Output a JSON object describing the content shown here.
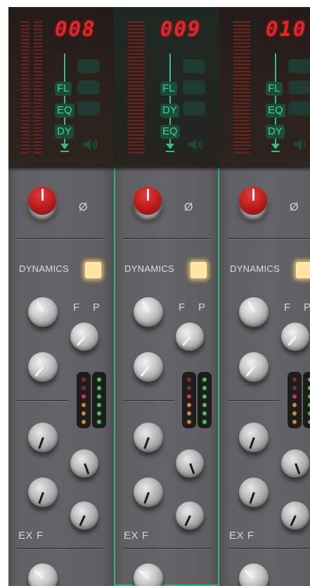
{
  "channels": [
    {
      "number": "008",
      "sends": [
        "FL",
        "EQ",
        "DY"
      ],
      "phase_symbol": "Ø",
      "dynamics_label": "DYNAMICS",
      "dyn_right_labels": [
        "F",
        "P"
      ],
      "bottom_labels": [
        "EX",
        "F"
      ]
    },
    {
      "number": "009",
      "sends": [
        "FL",
        "DY",
        "EQ"
      ],
      "phase_symbol": "Ø",
      "dynamics_label": "DYNAMICS",
      "dyn_right_labels": [
        "F",
        "P"
      ],
      "bottom_labels": [
        "EX",
        "F"
      ]
    },
    {
      "number": "010",
      "sends": [
        "FL",
        "EQ",
        "DY"
      ],
      "phase_symbol": "Ø",
      "dynamics_label": "DYNAMICS",
      "dyn_right_labels": [
        "F",
        "P"
      ],
      "bottom_labels": [
        "EX",
        "F"
      ]
    }
  ],
  "selected_channel": "009",
  "colors": {
    "accent": "#31c08a",
    "display_red": "#e8212a",
    "dynamics_on": "#ffe3a0",
    "panel": "#636365"
  },
  "icons": [
    "speaker-icon",
    "phase-invert-icon"
  ]
}
